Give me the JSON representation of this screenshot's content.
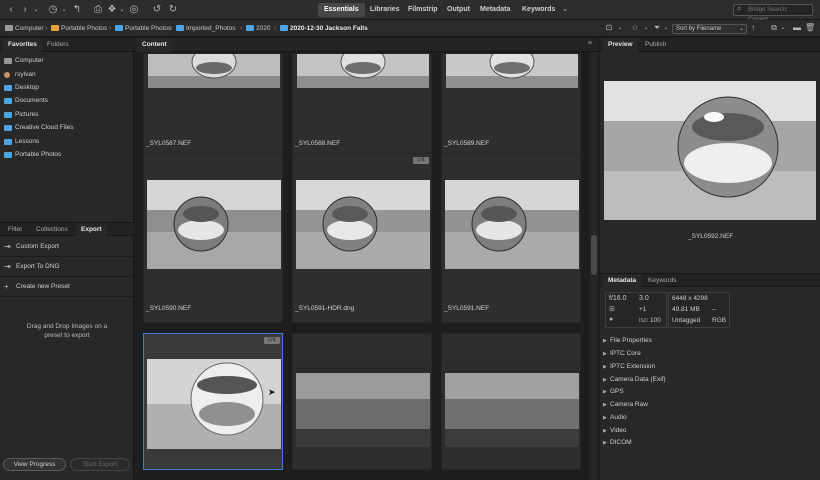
{
  "toolbar": {
    "workspaces": [
      "Essentials",
      "Libraries",
      "Filmstrip",
      "Output",
      "Metadata",
      "Keywords"
    ],
    "more_label": "⌄",
    "search_placeholder": "Bridge Search: Current..."
  },
  "path": {
    "crumbs": [
      "Computer",
      "Portable Photos",
      "Portable Photos",
      "Imported_Photos",
      "2020",
      "2020-12-30 Jackson Falls"
    ],
    "sort_label": "Sort by Filename"
  },
  "left": {
    "tabs": [
      "Favorites",
      "Folders"
    ],
    "favorites": [
      "Computer",
      "rsylvan",
      "Desktop",
      "Documents",
      "Pictures",
      "Creative Cloud Files",
      "Lessons",
      "Portable Photos"
    ],
    "lower_tabs": [
      "Filter",
      "Collections",
      "Export"
    ],
    "export_items": [
      "Custom Export",
      "Export To DNG",
      "Create new Preset"
    ],
    "drop_text": "Drag and Drop Images on a preset to export",
    "view_progress": "View Progress",
    "start_export": "Start Export"
  },
  "content": {
    "tab": "Content",
    "files": [
      "_SYL0587.NEF",
      "_SYL0588.NEF",
      "_SYL0589.NEF",
      "_SYL0590.NEF",
      "_SYL0591-HDR.dng",
      "_SYL0591.NEF"
    ]
  },
  "right": {
    "tabs": [
      "Preview",
      "Publish"
    ],
    "preview_name": "_SYL0592.NEF",
    "md_tabs": [
      "Metadata",
      "Keywords"
    ],
    "camera": {
      "aperture": "f/16.0",
      "shutter": "3.0",
      "dims": "6448 x 4298",
      "ev": "+1",
      "size": "49.81 MB",
      "dash": "--",
      "iso": "100",
      "iso_label": "ISO",
      "tag": "Untagged",
      "mode": "RGB"
    },
    "sections": [
      "File Properties",
      "IPTC Core",
      "IPTC Extension",
      "Camera Data (Exif)",
      "GPS",
      "Camera Raw",
      "Audio",
      "Video",
      "DICOM"
    ]
  }
}
